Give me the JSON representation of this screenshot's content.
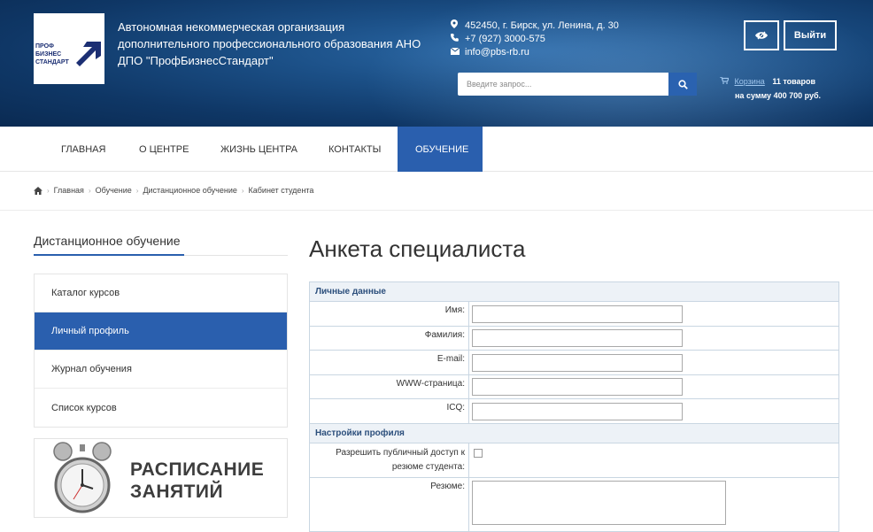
{
  "header": {
    "logo_lines": [
      "ПРОФ",
      "БИЗНЕС",
      "СТАНДАРТ"
    ],
    "org_name": "Автономная некоммерческая организация дополнительного профессионального образования АНО ДПО \"ПрофБизнесСтандарт\"",
    "address": "452450, г. Бирск, ул. Ленина, д. 30",
    "phone": "+7 (927) 3000-575",
    "email": "info@pbs-rb.ru",
    "search_placeholder": "Введите запрос...",
    "login_label": "Выйти",
    "cart": {
      "link": "Корзина",
      "count": "11 товаров",
      "sum_prefix": "на сумму",
      "sum": "400 700 руб."
    }
  },
  "nav": {
    "items": [
      {
        "label": "ГЛАВНАЯ"
      },
      {
        "label": "О ЦЕНТРЕ"
      },
      {
        "label": "ЖИЗНЬ ЦЕНТРА"
      },
      {
        "label": "КОНТАКТЫ"
      },
      {
        "label": "ОБУЧЕНИЕ"
      }
    ]
  },
  "breadcrumb": [
    "Главная",
    "Обучение",
    "Дистанционное обучение",
    "Кабинет студента"
  ],
  "sidebar": {
    "title": "Дистанционное обучение",
    "items": [
      {
        "label": "Каталог курсов"
      },
      {
        "label": "Личный профиль"
      },
      {
        "label": "Журнал обучения"
      },
      {
        "label": "Список курсов"
      }
    ],
    "banner_line1": "РАСПИСАНИЕ",
    "banner_line2": "ЗАНЯТИЙ"
  },
  "main": {
    "title": "Анкета специалиста",
    "section_personal": "Личные данные",
    "fields": [
      {
        "label": "Имя:",
        "value": ""
      },
      {
        "label": "Фамилия:",
        "value": ""
      },
      {
        "label": "E-mail:",
        "value": ""
      },
      {
        "label": "WWW-страница:",
        "value": ""
      },
      {
        "label": "ICQ:",
        "value": ""
      }
    ],
    "section_settings": "Настройки профиля",
    "public_access_label": "Разрешить публичный доступ к резюме студента:",
    "resume_label": "Резюме:"
  },
  "colors": {
    "accent": "#2a5fae",
    "header_bg": "#1b4f86"
  }
}
